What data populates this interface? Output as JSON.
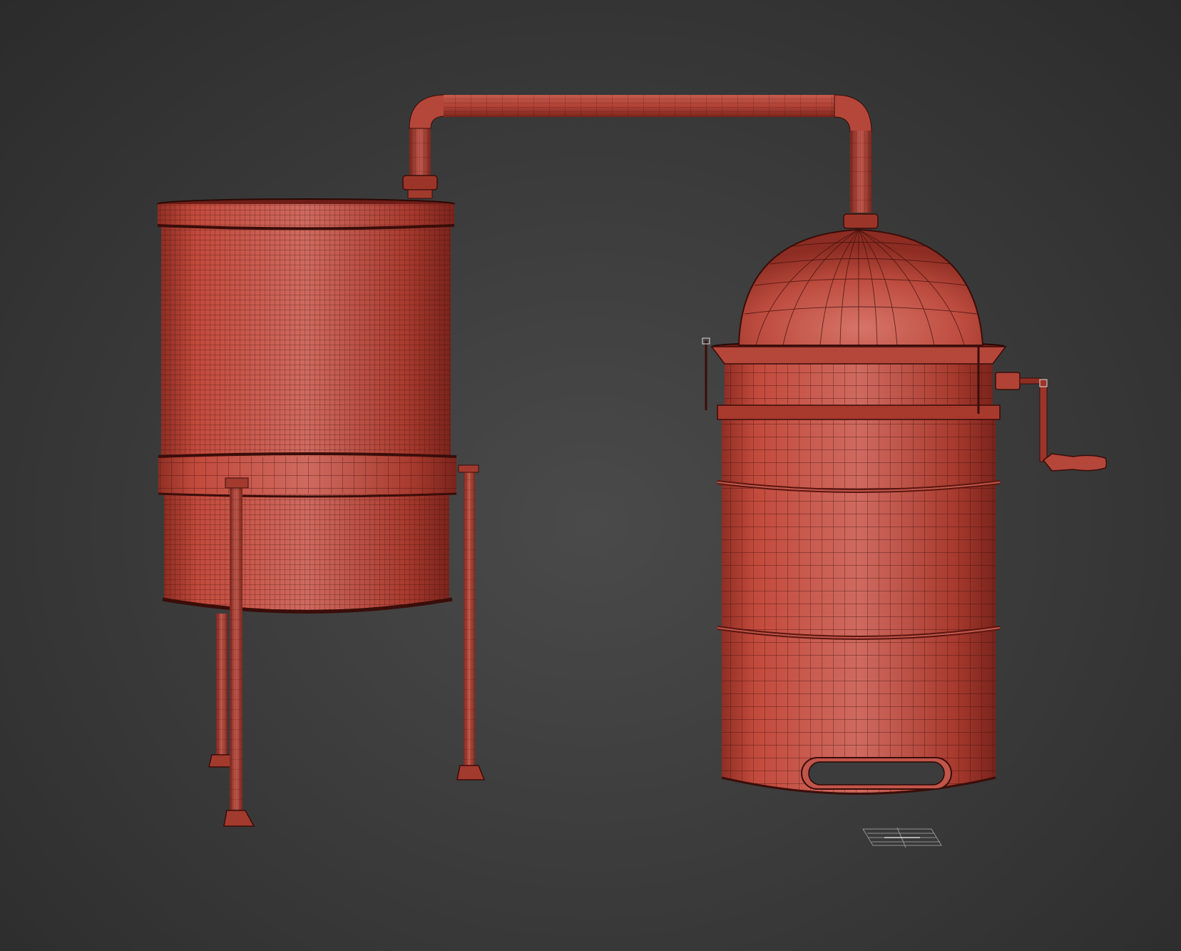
{
  "scene": {
    "background_color": "#3a3a3a",
    "material_color": "#b8473c",
    "wire_color": "#2a0c08",
    "objects": [
      "condenser-tank",
      "tank-stand-legs",
      "connecting-pipe",
      "still-boiler",
      "dome-lid",
      "crank-handle",
      "handle-cutout",
      "pivot-gizmo"
    ]
  }
}
